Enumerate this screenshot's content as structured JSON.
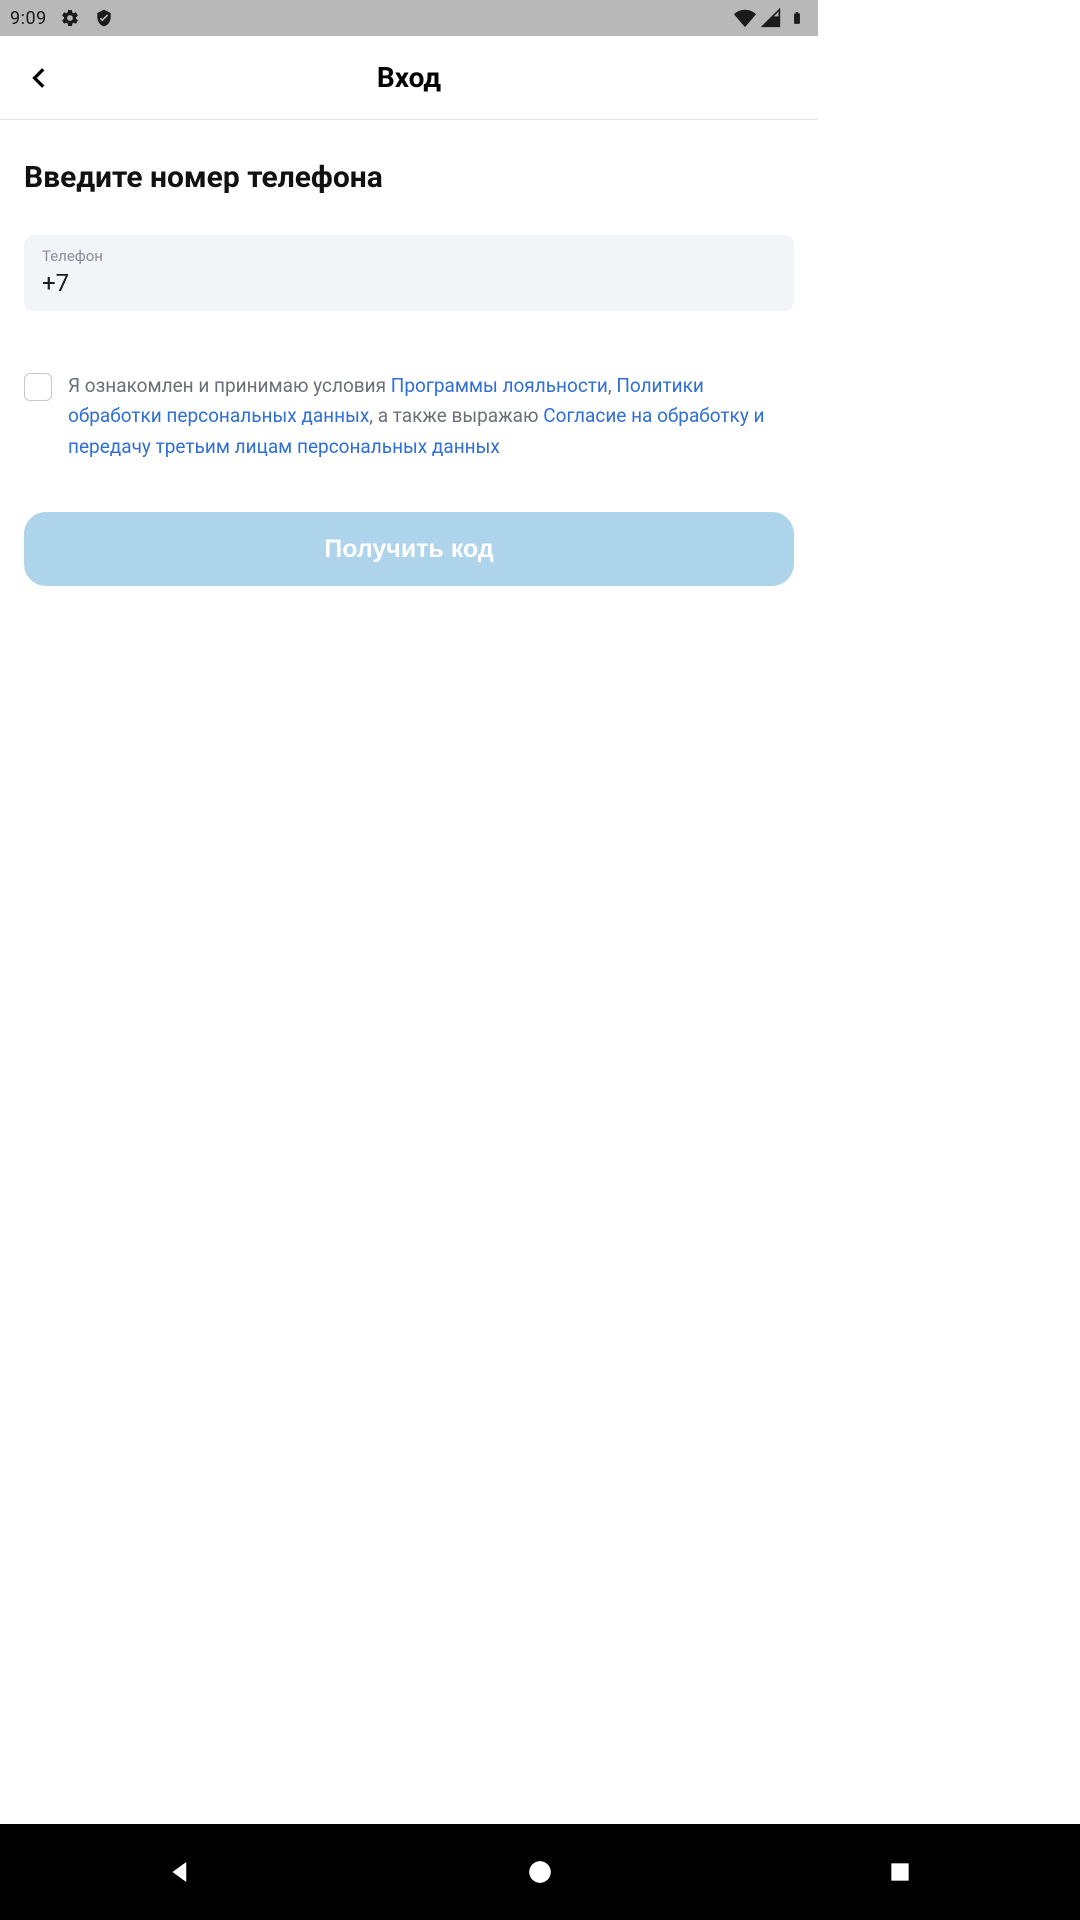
{
  "status": {
    "time": "9:09"
  },
  "header": {
    "title": "Вход"
  },
  "main": {
    "heading": "Введите номер телефона",
    "phone_field": {
      "label": "Телефон",
      "value": "+7"
    },
    "consent": {
      "prefix": "Я ознакомлен и принимаю условия ",
      "link1": "Программы лояльности",
      "sep1": ", ",
      "link2": "Политики обработки персональных данных",
      "sep2": ", а также выражаю ",
      "link3": "Согласие на обработку и передачу третьим лицам персональных данных"
    },
    "submit_label": "Получить код"
  }
}
